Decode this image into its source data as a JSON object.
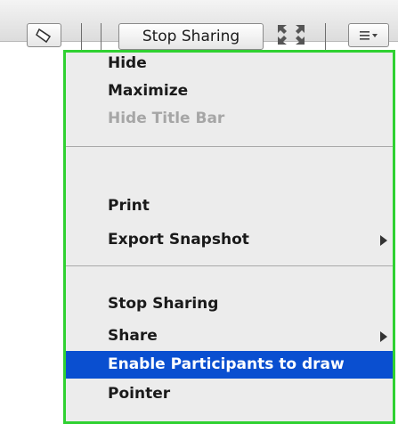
{
  "toolbar": {
    "stop_sharing_label": "Stop Sharing"
  },
  "menu": {
    "groups": [
      [
        {
          "label": "Hide",
          "enabled": true
        },
        {
          "label": "Maximize",
          "enabled": true
        },
        {
          "label": "Hide Title Bar",
          "enabled": false
        }
      ],
      [
        {
          "label": "Print",
          "enabled": true
        },
        {
          "label": "Export Snapshot",
          "enabled": true,
          "submenu": true
        }
      ],
      [
        {
          "label": "Stop Sharing",
          "enabled": true
        },
        {
          "label": "Share",
          "enabled": true,
          "submenu": true
        },
        {
          "label": "Enable Participants to draw",
          "enabled": true,
          "highlighted": true
        },
        {
          "label": "Pointer",
          "enabled": true
        }
      ]
    ]
  },
  "colors": {
    "highlight": "#0a4fd0",
    "menu_border": "#2fd131",
    "menu_bg": "#ececec"
  }
}
